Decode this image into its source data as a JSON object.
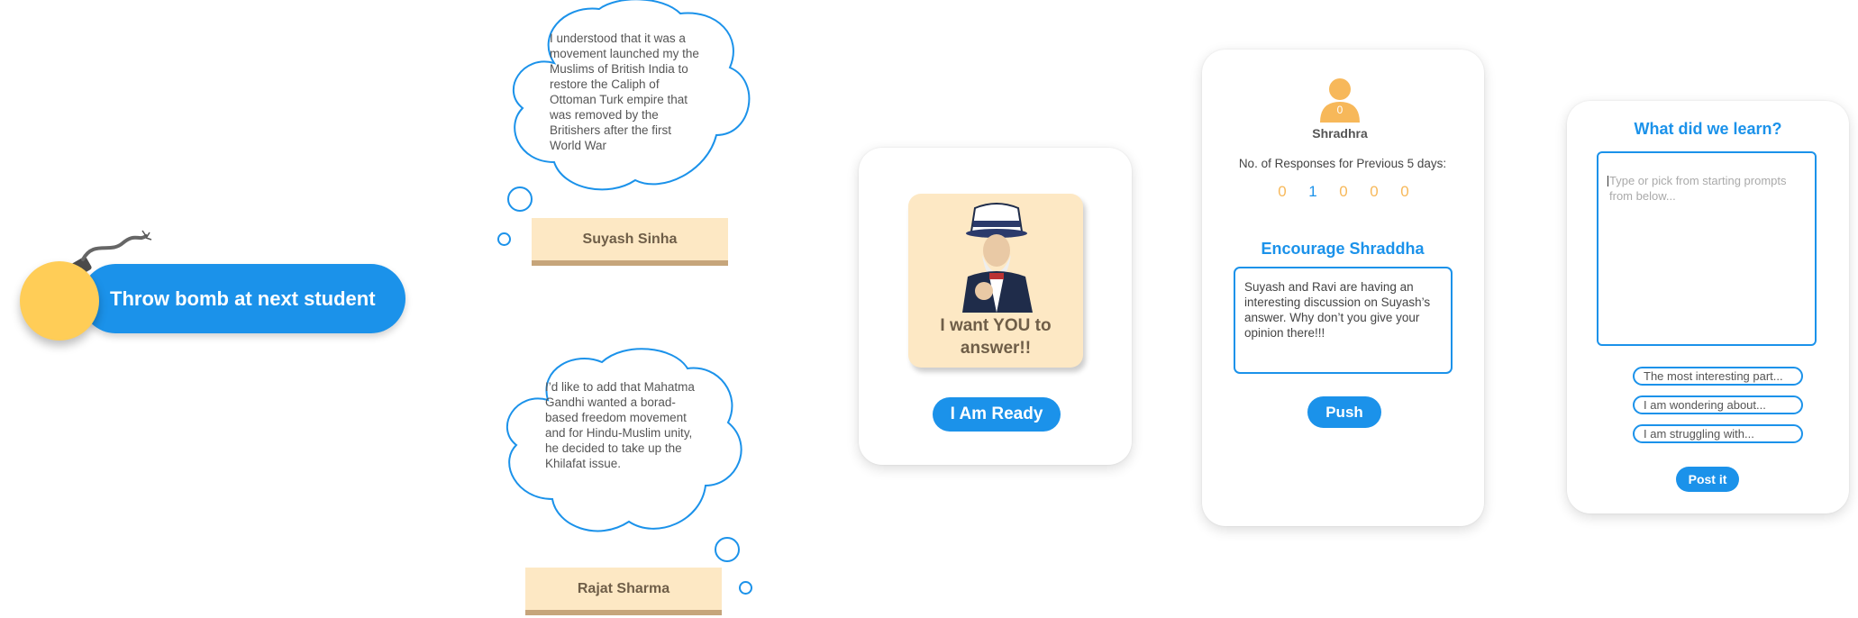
{
  "bomb": {
    "label": "Throw bomb at next student"
  },
  "thoughts": [
    {
      "text": "I understood that it was a movement launched my the Muslims of British India to restore the Caliph of Ottoman Turk empire that was removed by the Britishers after the first World War",
      "author": "Suyash Sinha"
    },
    {
      "text": "I’d like to add that Mahatma Gandhi wanted a borad-based freedom movement and for Hindu-Muslim unity, he decided to take up the Khilafat issue.",
      "author": "Rajat Sharma"
    }
  ],
  "ready_card": {
    "poster_text": "I want YOU to answer!!",
    "button": "I Am Ready"
  },
  "encourage_card": {
    "avatar_badge": "0",
    "student_name": "Shradhra",
    "responses_label": "No. of Responses for Previous 5 days:",
    "responses": [
      "0",
      "1",
      "0",
      "0",
      "0"
    ],
    "title": "Encourage Shraddha",
    "message": "Suyash and Ravi are having an interesting discussion on Suyash’s answer. Why don’t you give your opinion there!!!",
    "button": "Push"
  },
  "learn_card": {
    "title": "What did we learn?",
    "placeholder": "Type or pick from starting prompts from below...",
    "prompts": [
      "The most interesting part...",
      "I am wondering about...",
      "I am struggling with..."
    ],
    "button": "Post it"
  },
  "colors": {
    "primary": "#1b92ea",
    "accent": "#f7b85a",
    "bomb": "#ffcd57",
    "tag": "#fde8c4"
  },
  "icons": [
    "bomb-icon",
    "avatar-icon",
    "uncle-sam-illustration"
  ]
}
